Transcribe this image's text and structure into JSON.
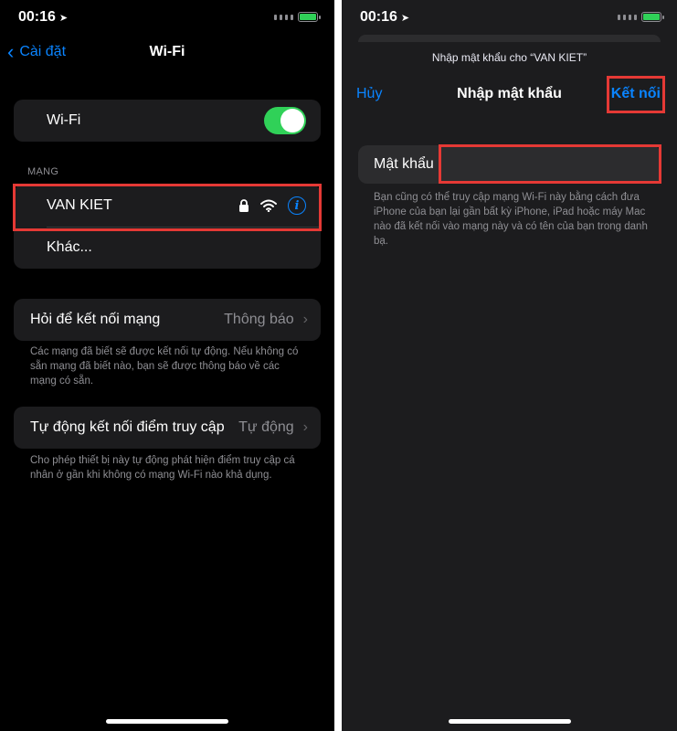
{
  "left": {
    "status": {
      "time": "00:16"
    },
    "nav": {
      "back_label": "Cài đặt",
      "title": "Wi-Fi"
    },
    "wifi_toggle": {
      "label": "Wi-Fi",
      "on": true
    },
    "networks_header": "MẠNG",
    "networks": [
      {
        "name": "VAN KIET",
        "locked": true,
        "highlighted": true
      },
      {
        "name": "Khác..."
      }
    ],
    "ask_to_join": {
      "label": "Hỏi để kết nối mạng",
      "value": "Thông báo",
      "footnote": "Các mạng đã biết sẽ được kết nối tự động. Nếu không có sẵn mạng đã biết nào, bạn sẽ được thông báo về các mạng có sẵn."
    },
    "auto_join_hotspot": {
      "label": "Tự động kết nối điểm truy cập",
      "value": "Tự động",
      "footnote": "Cho phép thiết bị này tự động phát hiện điểm truy cập cá nhân ở gần khi không có mạng Wi-Fi nào khả dụng."
    }
  },
  "right": {
    "status": {
      "time": "00:16"
    },
    "sheet_caption": "Nhập mật khẩu cho “VAN KIET”",
    "cancel_label": "Hủy",
    "title": "Nhập mật khẩu",
    "join_label": "Kết nối",
    "password": {
      "label": "Mật khẩu",
      "value": "",
      "help": "Bạn cũng có thể truy cập mạng Wi-Fi này bằng cách đưa iPhone của bạn lại gần bất kỳ iPhone, iPad hoặc máy Mac nào đã kết nối vào mạng này và có tên của bạn trong danh bạ."
    }
  },
  "colors": {
    "accent": "#0a84ff",
    "toggle_on": "#30d158",
    "highlight": "#e53935",
    "cell_bg": "#1c1c1e",
    "secondary_text": "#8e8e93"
  },
  "icons": [
    "location-arrow-icon",
    "battery-charging-icon",
    "chevron-left-icon",
    "lock-icon",
    "wifi-icon",
    "info-icon",
    "chevron-right-icon"
  ]
}
